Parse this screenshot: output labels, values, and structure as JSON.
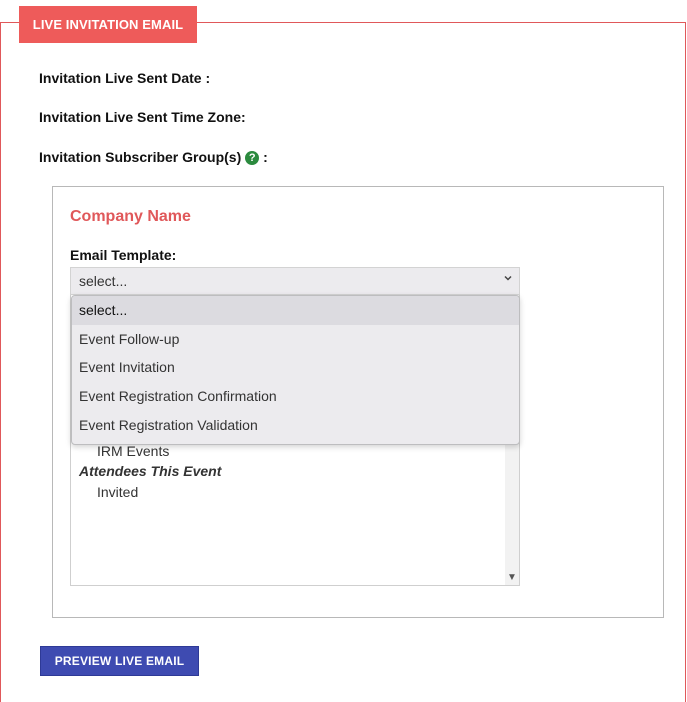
{
  "section": {
    "title": "LIVE INVITATION EMAIL"
  },
  "fields": {
    "sent_date_label": "Invitation Live Sent Date :",
    "time_zone_label": "Invitation Live Sent Time Zone:",
    "subscriber_label": "Invitation Subscriber Group(s)",
    "subscriber_suffix": ":",
    "help_glyph": "?"
  },
  "panel": {
    "company_name": "Company Name",
    "email_template_label": "Email Template:",
    "select": {
      "value": "select...",
      "icon": "chevron-down-icon"
    },
    "dropdown_options": [
      "select...",
      "Event Follow-up",
      "Event Invitation",
      "Event Registration Confirmation",
      "Event Registration Validation"
    ],
    "groups_list": {
      "items": [
        "IRM Events"
      ],
      "group_header": "Attendees This Event",
      "group_items": [
        "Invited"
      ]
    }
  },
  "actions": {
    "preview_label": "PREVIEW LIVE EMAIL"
  },
  "colors": {
    "accent": "#ee5b5a",
    "button": "#3e4bb1",
    "help": "#2b8a3e"
  }
}
